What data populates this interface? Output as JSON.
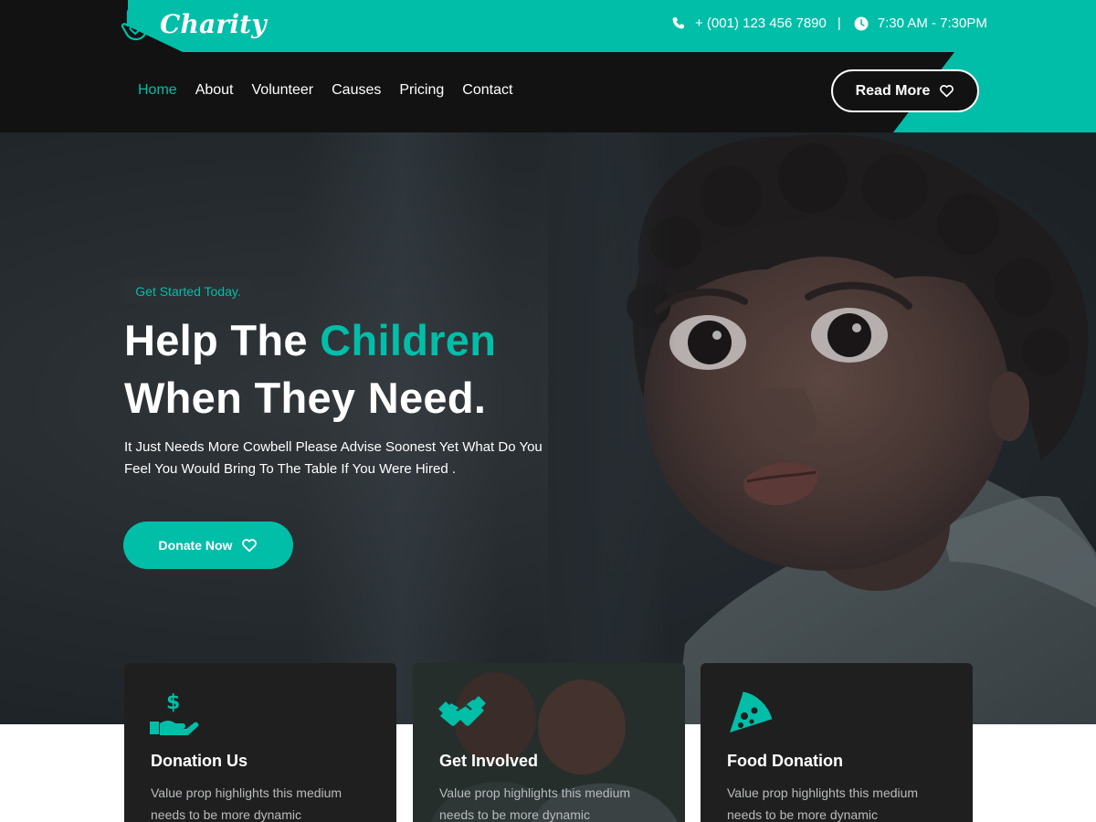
{
  "brand": {
    "name": "Charity",
    "logo_icon": "hand-heart-icon"
  },
  "topbar": {
    "phone": "+ (001) 123 456 7890",
    "separator": "|",
    "hours": "7:30 AM - 7:30PM"
  },
  "nav": {
    "items": [
      {
        "label": "Home",
        "active": true
      },
      {
        "label": "About"
      },
      {
        "label": "Volunteer"
      },
      {
        "label": "Causes"
      },
      {
        "label": "Pricing"
      },
      {
        "label": "Contact"
      }
    ],
    "cta_label": "Read More"
  },
  "hero": {
    "badge": "Get Started Today.",
    "headline_part1": "Help The ",
    "headline_accent": "Children",
    "headline_part2": "When They Need.",
    "subtext_line1": "It Just Needs More Cowbell Please Advise Soonest Yet What Do You",
    "subtext_line2": "Feel You Would Bring To The Table If You Were Hired .",
    "donate_label": "Donate Now"
  },
  "cards": [
    {
      "title": "Donation Us",
      "desc_line1": "Value prop highlights this medium",
      "desc_line2": "needs to be more dynamic",
      "icon": "hand-dollar-icon"
    },
    {
      "title": "Get Involved",
      "desc_line1": "Value prop highlights this medium",
      "desc_line2": "needs to be more dynamic",
      "icon": "handshake-icon"
    },
    {
      "title": "Food Donation",
      "desc_line1": "Value prop highlights this medium",
      "desc_line2": "needs to be more dynamic",
      "icon": "pizza-slice-icon"
    }
  ],
  "colors": {
    "accent": "#01bea8",
    "dark": "#121212",
    "card": "#1f1f1f"
  }
}
